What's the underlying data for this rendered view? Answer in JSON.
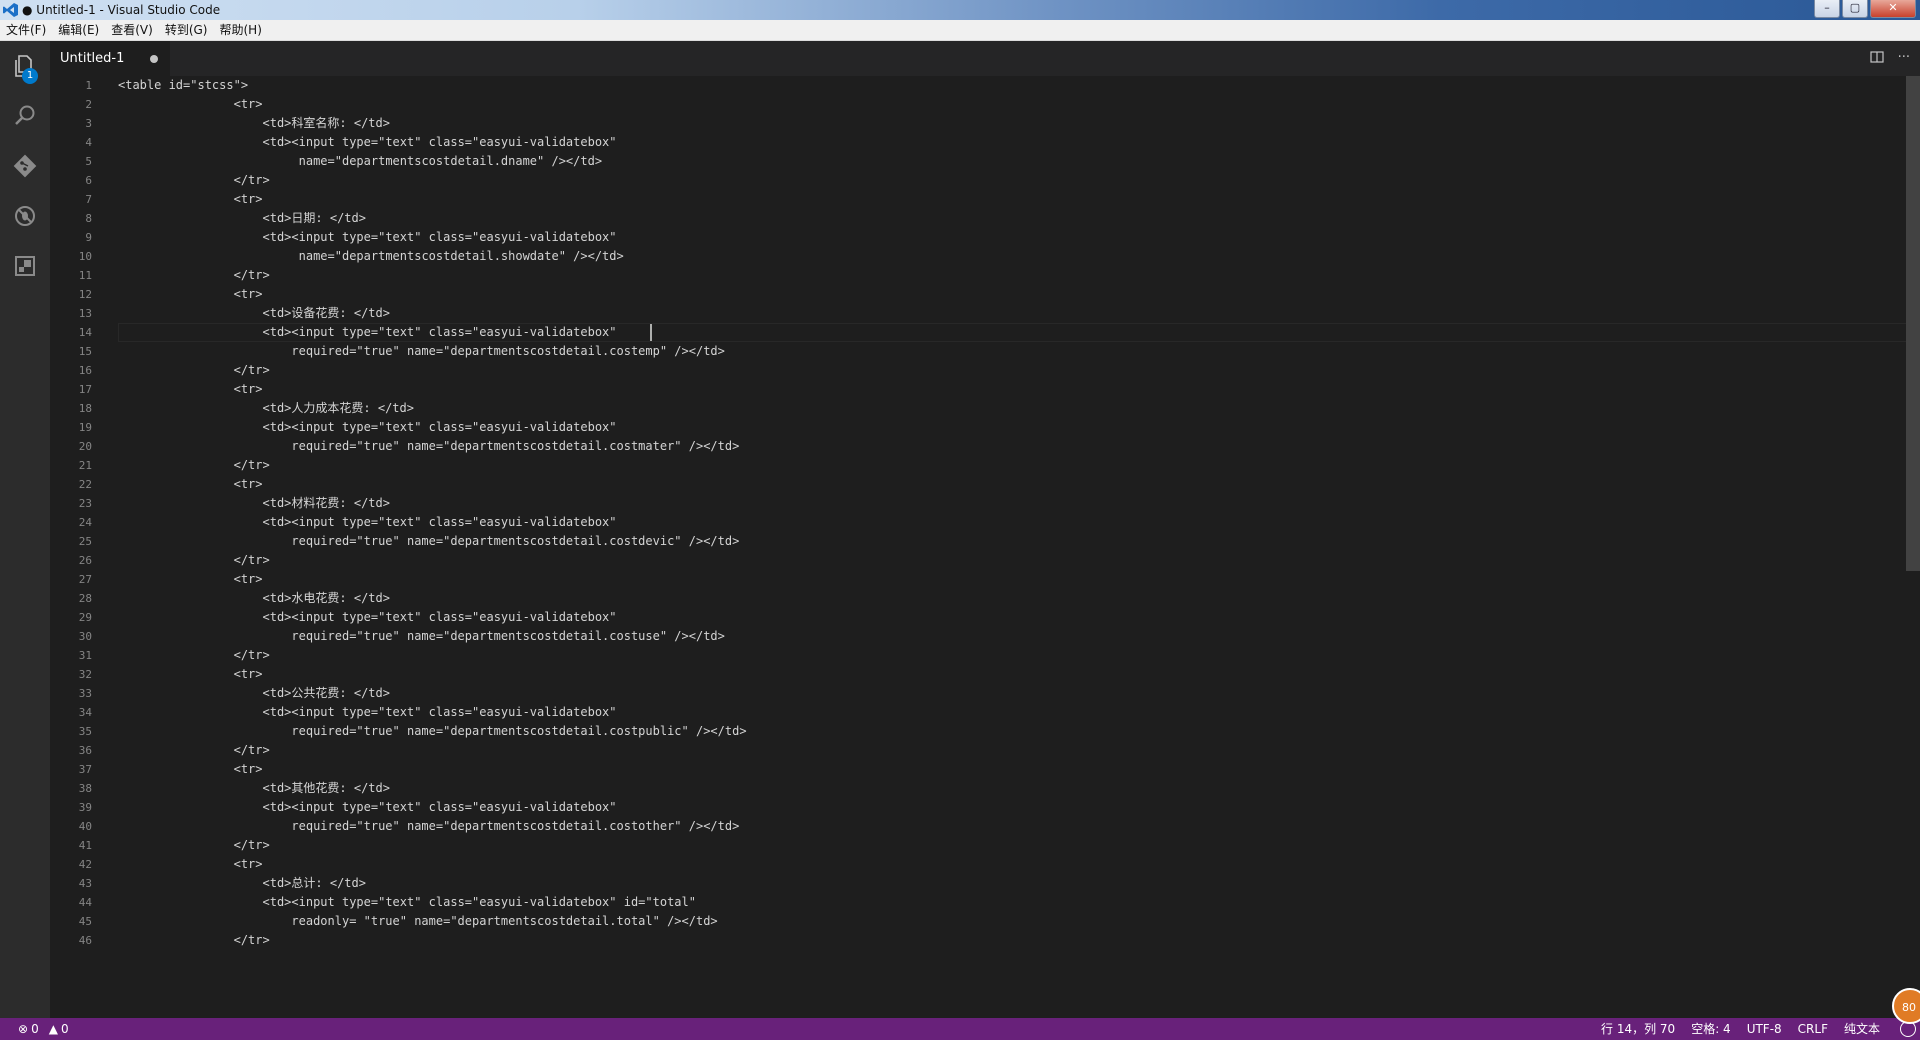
{
  "window": {
    "title": "● Untitled-1 - Visual Studio Code"
  },
  "menu": [
    "文件(F)",
    "编辑(E)",
    "查看(V)",
    "转到(G)",
    "帮助(H)"
  ],
  "activity_bar": {
    "items": [
      {
        "name": "explorer-icon",
        "badge": "1"
      },
      {
        "name": "search-icon"
      },
      {
        "name": "git-icon"
      },
      {
        "name": "debug-icon"
      },
      {
        "name": "extensions-icon"
      }
    ]
  },
  "tabs": [
    {
      "label": "Untitled-1",
      "dirty": true
    }
  ],
  "tab_actions": {
    "split_icon": "split-editor-icon",
    "more": "···"
  },
  "editor": {
    "cursor": {
      "line": 14,
      "column": 70
    },
    "lines": [
      "<table id=\"stcss\">",
      "\t\t\t\t<tr>",
      "\t\t\t\t\t<td>科室名称: </td>",
      "\t\t\t\t\t<td><input type=\"text\" class=\"easyui-validatebox\"",
      "\t\t\t\t\t     name=\"departmentscostdetail.dname\" /></td>",
      "\t\t\t\t</tr>",
      "\t\t\t\t<tr>",
      "\t\t\t\t\t<td>日期: </td>",
      "\t\t\t\t\t<td><input type=\"text\" class=\"easyui-validatebox\"",
      "\t\t\t\t\t     name=\"departmentscostdetail.showdate\" /></td>",
      "\t\t\t\t</tr>",
      "\t\t\t\t<tr>",
      "\t\t\t\t\t<td>设备花费: </td>",
      "\t\t\t\t\t<td><input type=\"text\" class=\"easyui-validatebox\"",
      "\t\t\t\t\t\trequired=\"true\" name=\"departmentscostdetail.costemp\" /></td>",
      "\t\t\t\t</tr>",
      "\t\t\t\t<tr>",
      "\t\t\t\t\t<td>人力成本花费: </td>",
      "\t\t\t\t\t<td><input type=\"text\" class=\"easyui-validatebox\"",
      "\t\t\t\t\t\trequired=\"true\" name=\"departmentscostdetail.costmater\" /></td>",
      "\t\t\t\t</tr>",
      "\t\t\t\t<tr>",
      "\t\t\t\t\t<td>材料花费: </td>",
      "\t\t\t\t\t<td><input type=\"text\" class=\"easyui-validatebox\"",
      "\t\t\t\t\t\trequired=\"true\" name=\"departmentscostdetail.costdevic\" /></td>",
      "\t\t\t\t</tr>",
      "\t\t\t\t<tr>",
      "\t\t\t\t\t<td>水电花费: </td>",
      "\t\t\t\t\t<td><input type=\"text\" class=\"easyui-validatebox\"",
      "\t\t\t\t\t\trequired=\"true\" name=\"departmentscostdetail.costuse\" /></td>",
      "\t\t\t\t</tr>",
      "\t\t\t\t<tr>",
      "\t\t\t\t\t<td>公共花费: </td>",
      "\t\t\t\t\t<td><input type=\"text\" class=\"easyui-validatebox\"",
      "\t\t\t\t\t\trequired=\"true\" name=\"departmentscostdetail.costpublic\" /></td>",
      "\t\t\t\t</tr>",
      "\t\t\t\t<tr>",
      "\t\t\t\t\t<td>其他花费: </td>",
      "\t\t\t\t\t<td><input type=\"text\" class=\"easyui-validatebox\"",
      "\t\t\t\t\t\trequired=\"true\" name=\"departmentscostdetail.costother\" /></td>",
      "\t\t\t\t</tr>",
      "\t\t\t\t<tr>",
      "\t\t\t\t\t<td>总计: </td>",
      "\t\t\t\t\t<td><input type=\"text\" class=\"easyui-validatebox\" id=\"total\"",
      "\t\t\t\t\t\treadonly= \"true\" name=\"departmentscostdetail.total\" /></td>",
      "\t\t\t\t</tr>"
    ]
  },
  "status": {
    "errors": "0",
    "warnings": "0",
    "position": "行 14，列 70",
    "spaces": "空格: 4",
    "encoding": "UTF-8",
    "eol": "CRLF",
    "language": "纯文本",
    "badge": "80"
  },
  "colors": {
    "statusbar": "#68217a",
    "editor_bg": "#1e1e1e",
    "activitybar": "#2c2c2c"
  }
}
